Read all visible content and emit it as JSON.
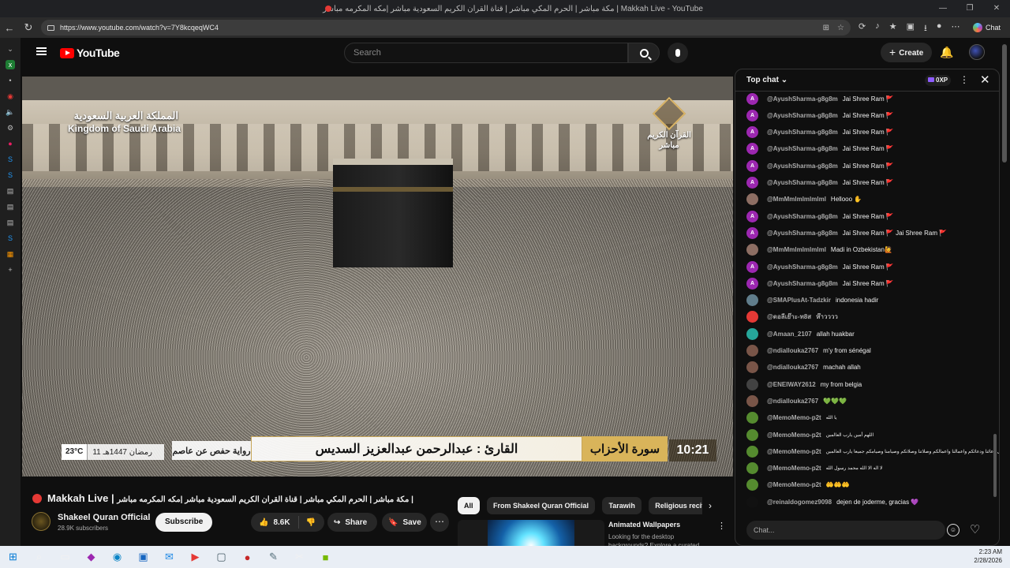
{
  "browser": {
    "tab_title": "مكة مباشر | الحرم المكي مباشر | قناة القران الكريم السعودية مباشر |مكه المكرمه مباشر | Makkah Live - YouTube",
    "url": "https://www.youtube.com/watch?v=7Y8kcqeqWC4",
    "chat_label": "Chat"
  },
  "masthead": {
    "logo_text": "YouTube",
    "search_placeholder": "Search",
    "create_label": "Create"
  },
  "video": {
    "overlay_country_ar": "المملكة العربية السعودية",
    "overlay_country_en": "Kingdom of Saudi Arabia",
    "overlay_channel_ar_1": "القرآن الكريم",
    "overlay_channel_ar_2": "مباشر",
    "lower_reader": "القارئ : عبدالرحمن عبدالعزيز السديس",
    "lower_surah": "سورة الأحزاب",
    "lower_narration": "رواية حفص عن عاصم",
    "lower_time": "10:21",
    "lower_temp": "23°C",
    "lower_date": "11 رمضان 1447هـ"
  },
  "meta": {
    "live_title": "Makkah Live",
    "title_ar": "مكة مباشر | الحرم المكي مباشر | قناة القران الكريم السعودية مباشر |مكه المكرمه مباشر |",
    "channel_name": "Shakeel Quran Official",
    "subscribers": "28.9K subscribers",
    "subscribe_label": "Subscribe",
    "likes": "8.6K",
    "share_label": "Share",
    "save_label": "Save"
  },
  "chips": [
    "All",
    "From Shakeel Quran Official",
    "Tarawih",
    "Religious recitat"
  ],
  "recommendation": {
    "title": "Animated Wallpapers",
    "desc": "Looking for the desktop backgrounds? Explore a curated"
  },
  "chat": {
    "mode_label": "Top chat",
    "xp_label": "0XP",
    "input_placeholder": "Chat...",
    "messages": [
      {
        "author": "@AyushSharma-g8g8m",
        "text": "Jai Shree Ram 🚩",
        "avatar_letter": "A",
        "avatar_color": "#9c27b0"
      },
      {
        "author": "@AyushSharma-g8g8m",
        "text": "Jai Shree Ram 🚩",
        "avatar_letter": "A",
        "avatar_color": "#9c27b0"
      },
      {
        "author": "@AyushSharma-g8g8m",
        "text": "Jai Shree Ram 🚩",
        "avatar_letter": "A",
        "avatar_color": "#9c27b0"
      },
      {
        "author": "@AyushSharma-g8g8m",
        "text": "Jai Shree Ram 🚩",
        "avatar_letter": "A",
        "avatar_color": "#9c27b0"
      },
      {
        "author": "@AyushSharma-g8g8m",
        "text": "Jai Shree Ram 🚩",
        "avatar_letter": "A",
        "avatar_color": "#9c27b0"
      },
      {
        "author": "@AyushSharma-g8g8m",
        "text": "Jai Shree Ram 🚩",
        "avatar_letter": "A",
        "avatar_color": "#9c27b0"
      },
      {
        "author": "@MmMmlmlmlmlml",
        "text": "Hellooo ✋",
        "avatar_letter": "",
        "avatar_color": "#8d6e63"
      },
      {
        "author": "@AyushSharma-g8g8m",
        "text": "Jai Shree Ram 🚩",
        "avatar_letter": "A",
        "avatar_color": "#9c27b0"
      },
      {
        "author": "@AyushSharma-g8g8m",
        "text": "Jai Shree Ram 🚩 Jai Shree Ram 🚩",
        "avatar_letter": "A",
        "avatar_color": "#9c27b0"
      },
      {
        "author": "@MmMmlmlmlmlml",
        "text": "Madi in Ozbekistan🙋",
        "avatar_letter": "",
        "avatar_color": "#8d6e63"
      },
      {
        "author": "@AyushSharma-g8g8m",
        "text": "Jai Shree Ram 🚩",
        "avatar_letter": "A",
        "avatar_color": "#9c27b0"
      },
      {
        "author": "@AyushSharma-g8g8m",
        "text": "Jai Shree Ram 🚩",
        "avatar_letter": "A",
        "avatar_color": "#9c27b0"
      },
      {
        "author": "@SMAPlusAt-Tadzkir",
        "text": "indonesia hadir",
        "avatar_letter": "",
        "avatar_color": "#607d8b"
      },
      {
        "author": "@ดอลีเย๊าะ-ท8ส",
        "text": "ห๊าวววว",
        "avatar_letter": "",
        "avatar_color": "#e53935"
      },
      {
        "author": "@Amaan_2107",
        "text": "allah huakbar",
        "avatar_letter": "",
        "avatar_color": "#26a69a"
      },
      {
        "author": "@ndiallouka2767",
        "text": "m'y from sénégal",
        "avatar_letter": "",
        "avatar_color": "#795548"
      },
      {
        "author": "@ndiallouka2767",
        "text": "machah allah",
        "avatar_letter": "",
        "avatar_color": "#795548"
      },
      {
        "author": "@ENEIWAY2612",
        "text": "my from belgia",
        "avatar_letter": "",
        "avatar_color": "#424242"
      },
      {
        "author": "@ndiallouka2767",
        "text": "💚💚💚",
        "avatar_letter": "",
        "avatar_color": "#795548"
      },
      {
        "author": "@MemoMemo-p2t",
        "text": "يا الله",
        "avatar_letter": "",
        "avatar_color": "#558b2f",
        "small": true
      },
      {
        "author": "@MemoMemo-p2t",
        "text": "اللهم أمين يارب العالمين",
        "avatar_letter": "",
        "avatar_color": "#558b2f",
        "small": true
      },
      {
        "author": "@MemoMemo-p2t",
        "text": "ربنا تقبل دعائنا ودعائكم واعمالنا واعمالكم وصلاتنا وصلاتكم وصيامنا وصيامكم جميعا يارب العالمين",
        "avatar_letter": "",
        "avatar_color": "#558b2f",
        "small": true
      },
      {
        "author": "@MemoMemo-p2t",
        "text": "لا اله الا الله محمد رسول الله",
        "avatar_letter": "",
        "avatar_color": "#558b2f",
        "small": true
      },
      {
        "author": "@MemoMemo-p2t",
        "text": "🤲🤲🤲",
        "avatar_letter": "",
        "avatar_color": "#558b2f"
      },
      {
        "author": "@reinaldogomez9098",
        "text": "dejen de joderme, gracias 💜",
        "avatar_letter": "",
        "avatar_color": "#111111"
      }
    ]
  },
  "taskbar": {
    "time": "2:23 AM",
    "date": "2/28/2026"
  }
}
